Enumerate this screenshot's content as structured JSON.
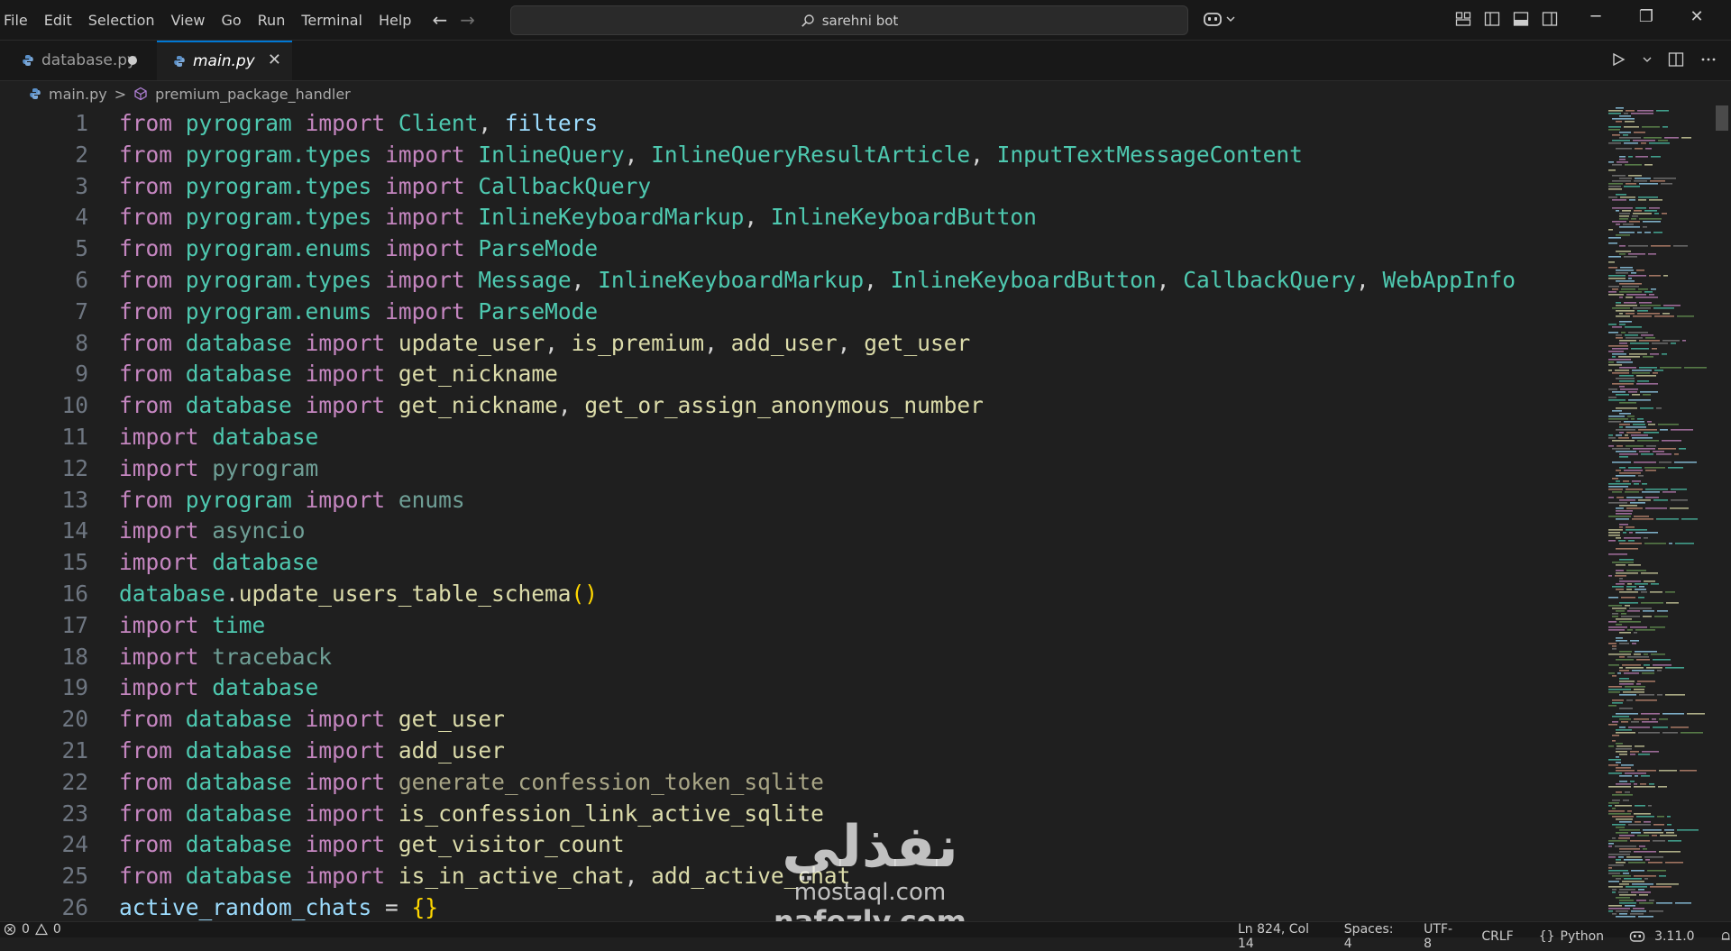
{
  "menu": [
    "File",
    "Edit",
    "Selection",
    "View",
    "Go",
    "Run",
    "Terminal",
    "Help"
  ],
  "nav": {
    "back": "←",
    "forward": "→"
  },
  "command_center": {
    "text": "sarehni bot"
  },
  "window_controls": {
    "minimize": "─",
    "restore": "❐",
    "close": "✕"
  },
  "tabs": [
    {
      "title": "database.py",
      "state": "modified"
    },
    {
      "title": "main.py",
      "state": "active"
    }
  ],
  "tab_close_glyph": "✕",
  "breadcrumb": {
    "file": "main.py",
    "separator": ">",
    "symbol": "premium_package_handler"
  },
  "editor_lines": [
    {
      "n": "1",
      "tokens": [
        [
          "kw",
          "from"
        ],
        [
          "punc",
          " "
        ],
        [
          "mod",
          "pyrogram"
        ],
        [
          "punc",
          " "
        ],
        [
          "kw",
          "import"
        ],
        [
          "punc",
          " "
        ],
        [
          "cls",
          "Client"
        ],
        [
          "punc",
          ", "
        ],
        [
          "var",
          "filters"
        ]
      ]
    },
    {
      "n": "2",
      "tokens": [
        [
          "kw",
          "from"
        ],
        [
          "punc",
          " "
        ],
        [
          "mod",
          "pyrogram.types"
        ],
        [
          "punc",
          " "
        ],
        [
          "kw",
          "import"
        ],
        [
          "punc",
          " "
        ],
        [
          "cls",
          "InlineQuery"
        ],
        [
          "punc",
          ", "
        ],
        [
          "cls",
          "InlineQueryResultArticle"
        ],
        [
          "punc",
          ", "
        ],
        [
          "cls",
          "InputTextMessageContent"
        ]
      ]
    },
    {
      "n": "3",
      "tokens": [
        [
          "kw",
          "from"
        ],
        [
          "punc",
          " "
        ],
        [
          "mod",
          "pyrogram.types"
        ],
        [
          "punc",
          " "
        ],
        [
          "kw",
          "import"
        ],
        [
          "punc",
          " "
        ],
        [
          "cls",
          "CallbackQuery"
        ]
      ]
    },
    {
      "n": "4",
      "tokens": [
        [
          "kw",
          "from"
        ],
        [
          "punc",
          " "
        ],
        [
          "mod",
          "pyrogram.types"
        ],
        [
          "punc",
          " "
        ],
        [
          "kw",
          "import"
        ],
        [
          "punc",
          " "
        ],
        [
          "cls",
          "InlineKeyboardMarkup"
        ],
        [
          "punc",
          ", "
        ],
        [
          "cls",
          "InlineKeyboardButton"
        ]
      ]
    },
    {
      "n": "5",
      "tokens": [
        [
          "kw",
          "from"
        ],
        [
          "punc",
          " "
        ],
        [
          "mod",
          "pyrogram.enums"
        ],
        [
          "punc",
          " "
        ],
        [
          "kw",
          "import"
        ],
        [
          "punc",
          " "
        ],
        [
          "cls",
          "ParseMode"
        ]
      ]
    },
    {
      "n": "6",
      "tokens": [
        [
          "kw",
          "from"
        ],
        [
          "punc",
          " "
        ],
        [
          "mod",
          "pyrogram.types"
        ],
        [
          "punc",
          " "
        ],
        [
          "kw",
          "import"
        ],
        [
          "punc",
          " "
        ],
        [
          "cls",
          "Message"
        ],
        [
          "punc",
          ", "
        ],
        [
          "cls",
          "InlineKeyboardMarkup"
        ],
        [
          "punc",
          ", "
        ],
        [
          "cls",
          "InlineKeyboardButton"
        ],
        [
          "punc",
          ", "
        ],
        [
          "cls",
          "CallbackQuery"
        ],
        [
          "punc",
          ", "
        ],
        [
          "cls",
          "WebAppInfo"
        ]
      ]
    },
    {
      "n": "7",
      "tokens": [
        [
          "kw",
          "from"
        ],
        [
          "punc",
          " "
        ],
        [
          "mod",
          "pyrogram.enums"
        ],
        [
          "punc",
          " "
        ],
        [
          "kw",
          "import"
        ],
        [
          "punc",
          " "
        ],
        [
          "cls",
          "ParseMode"
        ]
      ]
    },
    {
      "n": "8",
      "tokens": [
        [
          "kw",
          "from"
        ],
        [
          "punc",
          " "
        ],
        [
          "mod",
          "database"
        ],
        [
          "punc",
          " "
        ],
        [
          "kw",
          "import"
        ],
        [
          "punc",
          " "
        ],
        [
          "fn",
          "update_user"
        ],
        [
          "punc",
          ", "
        ],
        [
          "fn",
          "is_premium"
        ],
        [
          "punc",
          ", "
        ],
        [
          "fn",
          "add_user"
        ],
        [
          "punc",
          ", "
        ],
        [
          "fn",
          "get_user"
        ]
      ]
    },
    {
      "n": "9",
      "tokens": [
        [
          "kw",
          "from"
        ],
        [
          "punc",
          " "
        ],
        [
          "mod",
          "database"
        ],
        [
          "punc",
          " "
        ],
        [
          "kw",
          "import"
        ],
        [
          "punc",
          " "
        ],
        [
          "fn",
          "get_nickname"
        ]
      ]
    },
    {
      "n": "10",
      "tokens": [
        [
          "kw",
          "from"
        ],
        [
          "punc",
          " "
        ],
        [
          "mod",
          "database"
        ],
        [
          "punc",
          " "
        ],
        [
          "kw",
          "import"
        ],
        [
          "punc",
          " "
        ],
        [
          "fn",
          "get_nickname"
        ],
        [
          "punc",
          ", "
        ],
        [
          "fn",
          "get_or_assign_anonymous_number"
        ]
      ]
    },
    {
      "n": "11",
      "tokens": [
        [
          "kw",
          "import"
        ],
        [
          "punc",
          " "
        ],
        [
          "mod",
          "database"
        ]
      ]
    },
    {
      "n": "12",
      "tokens": [
        [
          "kw",
          "import"
        ],
        [
          "punc",
          " "
        ],
        [
          "dim",
          "pyrogram"
        ]
      ]
    },
    {
      "n": "13",
      "tokens": [
        [
          "kw",
          "from"
        ],
        [
          "punc",
          " "
        ],
        [
          "mod",
          "pyrogram"
        ],
        [
          "punc",
          " "
        ],
        [
          "kw",
          "import"
        ],
        [
          "punc",
          " "
        ],
        [
          "dim",
          "enums"
        ]
      ]
    },
    {
      "n": "14",
      "tokens": [
        [
          "kw",
          "import"
        ],
        [
          "punc",
          " "
        ],
        [
          "dim",
          "asyncio"
        ]
      ]
    },
    {
      "n": "15",
      "tokens": [
        [
          "kw",
          "import"
        ],
        [
          "punc",
          " "
        ],
        [
          "mod",
          "database"
        ]
      ]
    },
    {
      "n": "16",
      "tokens": [
        [
          "mod",
          "database"
        ],
        [
          "punc",
          "."
        ],
        [
          "fn",
          "update_users_table_schema"
        ],
        [
          "brace",
          "()"
        ]
      ]
    },
    {
      "n": "17",
      "tokens": [
        [
          "kw",
          "import"
        ],
        [
          "punc",
          " "
        ],
        [
          "mod",
          "time"
        ]
      ]
    },
    {
      "n": "18",
      "tokens": [
        [
          "kw",
          "import"
        ],
        [
          "punc",
          " "
        ],
        [
          "dim",
          "traceback"
        ]
      ]
    },
    {
      "n": "19",
      "tokens": [
        [
          "kw",
          "import"
        ],
        [
          "punc",
          " "
        ],
        [
          "mod",
          "database"
        ]
      ]
    },
    {
      "n": "20",
      "tokens": [
        [
          "kw",
          "from"
        ],
        [
          "punc",
          " "
        ],
        [
          "mod",
          "database"
        ],
        [
          "punc",
          " "
        ],
        [
          "kw",
          "import"
        ],
        [
          "punc",
          " "
        ],
        [
          "fn",
          "get_user"
        ]
      ]
    },
    {
      "n": "21",
      "tokens": [
        [
          "kw",
          "from"
        ],
        [
          "punc",
          " "
        ],
        [
          "mod",
          "database"
        ],
        [
          "punc",
          " "
        ],
        [
          "kw",
          "import"
        ],
        [
          "punc",
          " "
        ],
        [
          "fn",
          "add_user"
        ]
      ]
    },
    {
      "n": "22",
      "tokens": [
        [
          "kw",
          "from"
        ],
        [
          "punc",
          " "
        ],
        [
          "mod",
          "database"
        ],
        [
          "punc",
          " "
        ],
        [
          "kw",
          "import"
        ],
        [
          "punc",
          " "
        ],
        [
          "dimfn",
          "generate_confession_token_sqlite"
        ]
      ]
    },
    {
      "n": "23",
      "tokens": [
        [
          "kw",
          "from"
        ],
        [
          "punc",
          " "
        ],
        [
          "mod",
          "database"
        ],
        [
          "punc",
          " "
        ],
        [
          "kw",
          "import"
        ],
        [
          "punc",
          " "
        ],
        [
          "fn",
          "is_confession_link_active_sqlite"
        ]
      ]
    },
    {
      "n": "24",
      "tokens": [
        [
          "kw",
          "from"
        ],
        [
          "punc",
          " "
        ],
        [
          "mod",
          "database"
        ],
        [
          "punc",
          " "
        ],
        [
          "kw",
          "import"
        ],
        [
          "punc",
          " "
        ],
        [
          "fn",
          "get_visitor_count"
        ]
      ]
    },
    {
      "n": "25",
      "tokens": [
        [
          "kw",
          "from"
        ],
        [
          "punc",
          " "
        ],
        [
          "mod",
          "database"
        ],
        [
          "punc",
          " "
        ],
        [
          "kw",
          "import"
        ],
        [
          "punc",
          " "
        ],
        [
          "fn",
          "is_in_active_chat"
        ],
        [
          "punc",
          ", "
        ],
        [
          "fn",
          "add_active_chat"
        ]
      ]
    },
    {
      "n": "26",
      "tokens": [
        [
          "var",
          "active_random_chats"
        ],
        [
          "punc",
          " = "
        ],
        [
          "brace",
          "{}"
        ]
      ]
    }
  ],
  "watermark": {
    "logo": "نفذلي",
    "line1": "mostaql.com",
    "line2": "nafezly.com"
  },
  "status": {
    "errors": "0",
    "warnings": "0",
    "position": "Ln 824, Col 14",
    "spaces": "Spaces: 4",
    "encoding": "UTF-8",
    "eol": "CRLF",
    "language": "Python",
    "version": "3.11.0"
  },
  "colors": {
    "keyword": "#c586c0",
    "module": "#4ec9b0",
    "function": "#dcdcaa",
    "variable": "#9cdcfe",
    "accent": "#0078d4"
  }
}
